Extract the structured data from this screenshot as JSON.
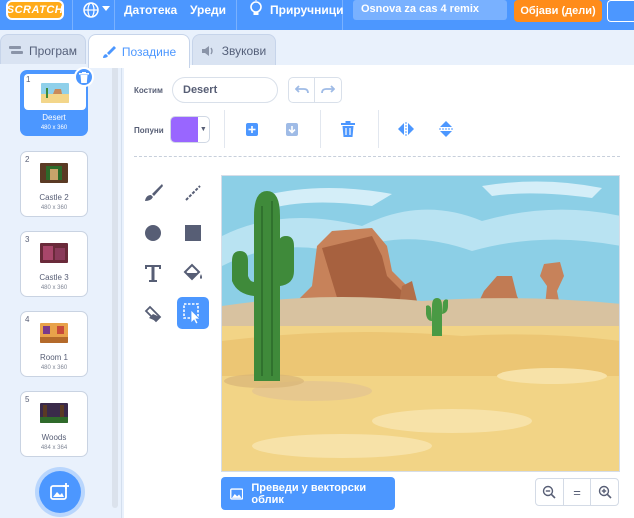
{
  "menubar": {
    "logo": "SCRATCH",
    "items": [
      "Датотека",
      "Уреди",
      "Приручници"
    ],
    "project_title": "Osnova za cas 4 remix",
    "share_label": "Објави (дели)",
    "icons": [
      "globe-icon",
      "chevron-down-icon",
      "lightbulb-icon"
    ]
  },
  "tabs": [
    {
      "label": "Програм",
      "icon": "code-icon",
      "active": false
    },
    {
      "label": "Позадине",
      "icon": "brush-icon",
      "active": true
    },
    {
      "label": "Звукови",
      "icon": "speaker-icon",
      "active": false
    }
  ],
  "costumes": [
    {
      "num": "1",
      "name": "Desert",
      "size": "480 x 360",
      "selected": true
    },
    {
      "num": "2",
      "name": "Castle 2",
      "size": "480 x 360",
      "selected": false
    },
    {
      "num": "3",
      "name": "Castle 3",
      "size": "480 x 360",
      "selected": false
    },
    {
      "num": "4",
      "name": "Room 1",
      "size": "480 x 360",
      "selected": false
    },
    {
      "num": "5",
      "name": "Woods",
      "size": "484 x 364",
      "selected": false
    }
  ],
  "editor": {
    "costume_label": "Костим",
    "costume_name": "Desert",
    "fill_label": "Попуни",
    "fill_color": "#9966ff",
    "convert_label": "Преведи у векторски облик",
    "zoom": [
      "−",
      "=",
      "+"
    ]
  },
  "colors": {
    "brand": "#4c97ff",
    "share": "#ff8c1a",
    "logo": "#ffab19"
  }
}
